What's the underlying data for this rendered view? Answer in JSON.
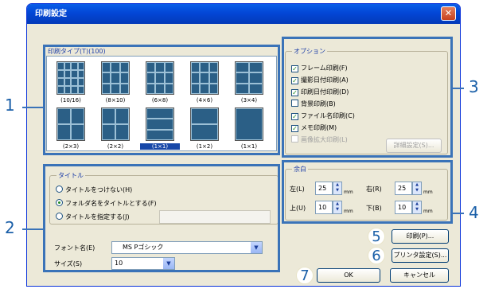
{
  "window": {
    "title": "印刷設定",
    "close_glyph": "✕"
  },
  "subtitle": "",
  "print_type": {
    "group_label": "印刷タイプ(T)(100)",
    "items": [
      {
        "label": "(10/16)",
        "cols": 4,
        "rows": 4,
        "selected": false
      },
      {
        "label": "(8×10)",
        "cols": 3,
        "rows": 3,
        "selected": false
      },
      {
        "label": "(6×8)",
        "cols": 3,
        "rows": 3,
        "selected": false
      },
      {
        "label": "(4×6)",
        "cols": 3,
        "rows": 3,
        "selected": false
      },
      {
        "label": "(3×4)",
        "cols": 2,
        "rows": 3,
        "selected": false
      },
      {
        "label": "(2×3)",
        "cols": 2,
        "rows": 2,
        "selected": false
      },
      {
        "label": "(2×2)",
        "cols": 2,
        "rows": 2,
        "selected": false
      },
      {
        "label": "(1×1)",
        "cols": 1,
        "rows": 3,
        "selected": true
      },
      {
        "label": "(1×2)",
        "cols": 1,
        "rows": 2,
        "selected": false
      },
      {
        "label": "(1×1)",
        "cols": 1,
        "rows": 1,
        "selected": false
      }
    ]
  },
  "options": {
    "group_label": "オプション",
    "items": [
      {
        "label": "フレーム印刷(F)",
        "checked": true,
        "disabled": false
      },
      {
        "label": "撮影日付印刷(A)",
        "checked": true,
        "disabled": false
      },
      {
        "label": "印刷日付印刷(D)",
        "checked": true,
        "disabled": false
      },
      {
        "label": "背景印刷(B)",
        "checked": false,
        "disabled": false
      },
      {
        "label": "ファイル名印刷(C)",
        "checked": true,
        "disabled": false
      },
      {
        "label": "メモ印刷(M)",
        "checked": true,
        "disabled": false
      },
      {
        "label": "画像拡大印刷(L)",
        "checked": false,
        "disabled": true
      }
    ],
    "detail_button": "詳細設定(S)..."
  },
  "title_group": {
    "group_label": "タイトル",
    "radios": [
      {
        "label": "タイトルをつけない(H)",
        "selected": false
      },
      {
        "label": "フォルダ名をタイトルとする(F)",
        "selected": true
      },
      {
        "label": "タイトルを指定する(J)",
        "selected": false
      }
    ],
    "title_value": "",
    "font_label": "フォント名(E)",
    "font_value": "MS Pゴシック",
    "size_label": "サイズ(S)",
    "size_value": "10"
  },
  "margin": {
    "group_label": "余白",
    "left_label": "左(L)",
    "left_value": "25",
    "right_label": "右(R)",
    "right_value": "25",
    "top_label": "上(U)",
    "top_value": "10",
    "bottom_label": "下(B)",
    "bottom_value": "10",
    "unit": "mm"
  },
  "buttons": {
    "print": "印刷(P)...",
    "printer_setup": "プリンタ設定(S)...",
    "ok": "OK",
    "cancel": "キャンセル"
  },
  "callouts": [
    "1",
    "2",
    "3",
    "4",
    "5",
    "6",
    "7"
  ],
  "colors": {
    "title_bar": "#0346d6",
    "callout_frame": "#3a73b8",
    "callout_number": "#1a5fa8"
  }
}
